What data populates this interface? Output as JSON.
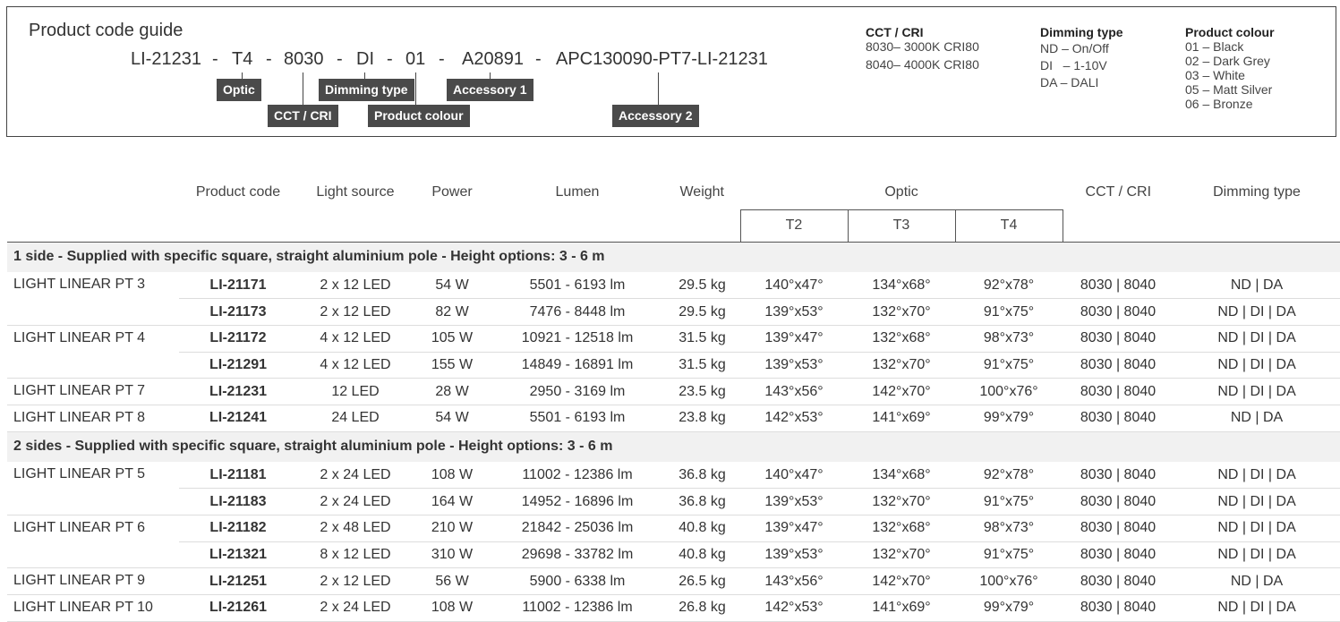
{
  "guide": {
    "title": "Product code guide",
    "code_parts": [
      "LI-21231",
      "-",
      "T4",
      "-",
      "8030",
      "-",
      "DI",
      "-",
      "01",
      "-",
      "A20891",
      "-",
      "APC130090-PT7-LI-21231"
    ],
    "tags": {
      "optic": "Optic",
      "cct": "CCT / CRI",
      "dimming": "Dimming type",
      "colour": "Product colour",
      "acc1": "Accessory 1",
      "acc2": "Accessory 2"
    },
    "legend_cct": {
      "title": "CCT / CRI",
      "items": [
        "8030– 3000K CRI80",
        "8040– 4000K CRI80"
      ]
    },
    "legend_dimming": {
      "title": "Dimming type",
      "items": [
        "ND – On/Off",
        "DI   – 1-10V",
        "DA – DALI"
      ]
    },
    "legend_colour": {
      "title": "Product colour",
      "items": [
        "01 – Black",
        "02 – Dark Grey",
        "03 – White",
        "05 – Matt Silver",
        "06 – Bronze"
      ]
    }
  },
  "table": {
    "headers": {
      "code": "Product code",
      "source": "Light source",
      "power": "Power",
      "lumen": "Lumen",
      "weight": "Weight",
      "optic": "Optic",
      "t2": "T2",
      "t3": "T3",
      "t4": "T4",
      "cct": "CCT / CRI",
      "dimming": "Dimming type"
    },
    "sections": [
      {
        "title": "1 side - Supplied with specific square, straight aluminium pole - Height options: 3 - 6 m",
        "groups": [
          {
            "name": "LIGHT LINEAR PT 3",
            "rows": [
              [
                "LI-21171",
                "2 x 12 LED",
                "54 W",
                "5501 - 6193 lm",
                "29.5 kg",
                "140°x47°",
                "134°x68°",
                "92°x78°",
                "8030 | 8040",
                "ND | DA"
              ],
              [
                "LI-21173",
                "2 x 12 LED",
                "82 W",
                "7476 - 8448 lm",
                "29.5 kg",
                "139°x53°",
                "132°x70°",
                "91°x75°",
                "8030 | 8040",
                "ND | DI | DA"
              ]
            ]
          },
          {
            "name": "LIGHT LINEAR PT 4",
            "rows": [
              [
                "LI-21172",
                "4 x 12 LED",
                "105 W",
                "10921 - 12518 lm",
                "31.5 kg",
                "139°x47°",
                "132°x68°",
                "98°x73°",
                "8030 | 8040",
                "ND | DI | DA"
              ],
              [
                "LI-21291",
                "4 x 12 LED",
                "155 W",
                "14849 - 16891 lm",
                "31.5 kg",
                "139°x53°",
                "132°x70°",
                "91°x75°",
                "8030 | 8040",
                "ND | DI | DA"
              ]
            ]
          },
          {
            "name": "LIGHT LINEAR PT 7",
            "rows": [
              [
                "LI-21231",
                "12 LED",
                "28 W",
                "2950 - 3169 lm",
                "23.5 kg",
                "143°x56°",
                "142°x70°",
                "100°x76°",
                "8030 | 8040",
                "ND | DI | DA"
              ]
            ]
          },
          {
            "name": "LIGHT LINEAR PT 8",
            "rows": [
              [
                "LI-21241",
                "24 LED",
                "54 W",
                "5501 - 6193 lm",
                "23.8 kg",
                "142°x53°",
                "141°x69°",
                "99°x79°",
                "8030 | 8040",
                "ND | DA"
              ]
            ]
          }
        ]
      },
      {
        "title": "2 sides - Supplied with specific square, straight aluminium pole - Height options: 3 - 6 m",
        "groups": [
          {
            "name": "LIGHT LINEAR PT 5",
            "rows": [
              [
                "LI-21181",
                "2 x 24 LED",
                "108 W",
                "11002 - 12386 lm",
                "36.8 kg",
                "140°x47°",
                "134°x68°",
                "92°x78°",
                "8030 | 8040",
                "ND | DI | DA"
              ],
              [
                "LI-21183",
                "2 x 24 LED",
                "164 W",
                "14952 - 16896 lm",
                "36.8 kg",
                "139°x53°",
                "132°x70°",
                "91°x75°",
                "8030 | 8040",
                "ND | DI | DA"
              ]
            ]
          },
          {
            "name": "LIGHT LINEAR PT 6",
            "rows": [
              [
                "LI-21182",
                "2 x 48 LED",
                "210 W",
                "21842 - 25036 lm",
                "40.8 kg",
                "139°x47°",
                "132°x68°",
                "98°x73°",
                "8030 | 8040",
                "ND | DI | DA"
              ],
              [
                "LI-21321",
                "8 x 12 LED",
                "310 W",
                "29698 - 33782 lm",
                "40.8 kg",
                "139°x53°",
                "132°x70°",
                "91°x75°",
                "8030 | 8040",
                "ND | DI | DA"
              ]
            ]
          },
          {
            "name": "LIGHT LINEAR PT 9",
            "rows": [
              [
                "LI-21251",
                "2 x 12 LED",
                "56 W",
                "5900 - 6338 lm",
                "26.5 kg",
                "143°x56°",
                "142°x70°",
                "100°x76°",
                "8030 | 8040",
                "ND | DA"
              ]
            ]
          },
          {
            "name": "LIGHT LINEAR PT 10",
            "rows": [
              [
                "LI-21261",
                "2 x 24 LED",
                "108 W",
                "11002 - 12386 lm",
                "26.8 kg",
                "142°x53°",
                "141°x69°",
                "99°x79°",
                "8030 | 8040",
                "ND | DI | DA"
              ]
            ]
          }
        ]
      }
    ]
  }
}
